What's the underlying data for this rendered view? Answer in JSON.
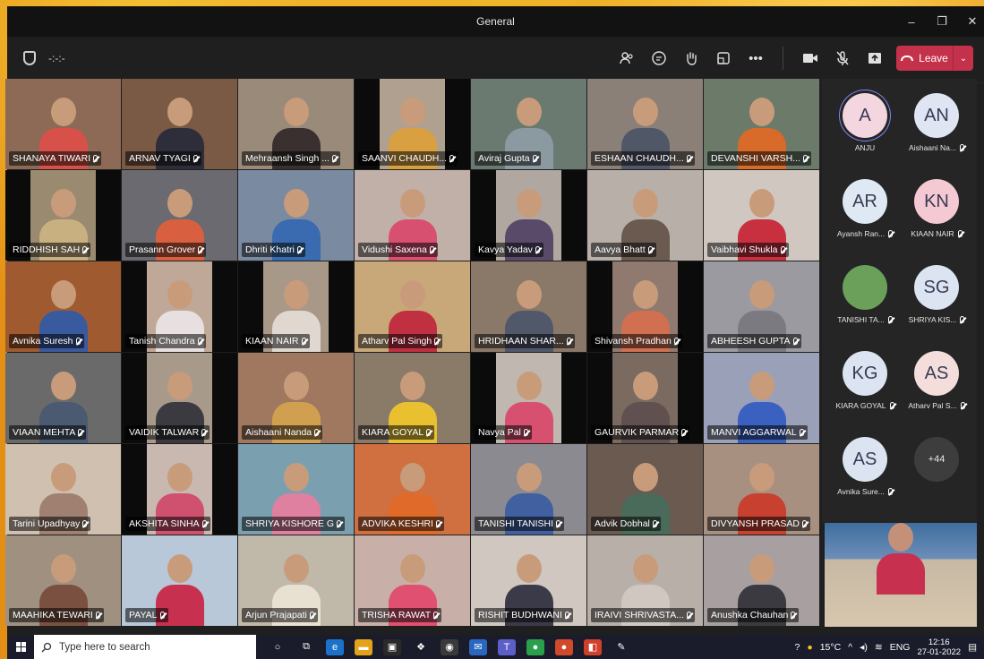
{
  "window": {
    "title": "General",
    "min": "–",
    "max": "❐",
    "close": "✕"
  },
  "toolbar": {
    "timer": "-:-:-",
    "leave_label": "Leave",
    "icons": [
      "people-icon",
      "chat-icon",
      "raise-hand-icon",
      "share-tray-icon",
      "more-icon",
      "camera-icon",
      "mic-off-icon",
      "share-icon"
    ]
  },
  "tiles": [
    {
      "name": "SHANAYA TIWARI",
      "bg": "#8c6a55",
      "shirt": "#d8504a"
    },
    {
      "name": "ARNAV TYAGI",
      "bg": "#7a5a45",
      "shirt": "#2e2e3a"
    },
    {
      "name": "Mehraansh Singh ...",
      "bg": "#9a8a7a",
      "shirt": "#3a3030"
    },
    {
      "name": "SAANVI CHAUDH...",
      "bg": "#b0a090",
      "shirt": "#d8a040",
      "bars": true
    },
    {
      "name": "Aviraj Gupta",
      "bg": "#6a7a70",
      "shirt": "#8a9aa0"
    },
    {
      "name": "ESHAAN CHAUDH...",
      "bg": "#8a8078",
      "shirt": "#505868"
    },
    {
      "name": "DEVANSHI VARSH...",
      "bg": "#6c7a6a",
      "shirt": "#d86a2a"
    },
    {
      "name": "RIDDHISH SAH",
      "bg": "#9a8a70",
      "shirt": "#c8b080",
      "bars": true
    },
    {
      "name": "Prasann Grover",
      "bg": "#6a6a70",
      "shirt": "#d86040"
    },
    {
      "name": "Dhriti Khatri",
      "bg": "#7a8aa0",
      "shirt": "#3a6ab0"
    },
    {
      "name": "Vidushi Saxena",
      "bg": "#c0b0a8",
      "shirt": "#d85070"
    },
    {
      "name": "Kavya Yadav",
      "bg": "#b0a8a0",
      "shirt": "#5a4a6a",
      "bars": true
    },
    {
      "name": "Aavya Bhatt",
      "bg": "#b8b0a8",
      "shirt": "#6a5a50"
    },
    {
      "name": "Vaibhavi Shukla",
      "bg": "#d0c8c0",
      "shirt": "#c83040"
    },
    {
      "name": "Avnika Suresh",
      "bg": "#a05a30",
      "shirt": "#3a5aa0"
    },
    {
      "name": "Tanish Chandra",
      "bg": "#c0a898",
      "shirt": "#e8e0e0",
      "bars": true
    },
    {
      "name": "KIAAN NAIR",
      "bg": "#a89888",
      "shirt": "#e0d8d0",
      "bars": true
    },
    {
      "name": "Atharv Pal Singh",
      "bg": "#c8a878",
      "shirt": "#c03040"
    },
    {
      "name": "HRIDHAAN SHAR...",
      "bg": "#8a7868",
      "shirt": "#50586a"
    },
    {
      "name": "Shivansh Pradhan",
      "bg": "#907a70",
      "shirt": "#d07050",
      "bars": true
    },
    {
      "name": "ABHEESH GUPTA",
      "bg": "#9a9aa0",
      "shirt": "#7a7a80"
    },
    {
      "name": "VIAAN MEHTA",
      "bg": "#6a6a6a",
      "shirt": "#4a5a70"
    },
    {
      "name": "VAIDIK TALWAR",
      "bg": "#a89a8a",
      "shirt": "#3a3a40",
      "bars": true
    },
    {
      "name": "Aishaani Nanda",
      "bg": "#a07860",
      "shirt": "#d0a050"
    },
    {
      "name": "KIARA GOYAL",
      "bg": "#8a7a68",
      "shirt": "#e8c030"
    },
    {
      "name": "Navya Pal",
      "bg": "#c0b8b0",
      "shirt": "#d85070",
      "bars": true
    },
    {
      "name": "GAURVIK PARMAR",
      "bg": "#7a6a60",
      "shirt": "#605050",
      "bars": true
    },
    {
      "name": "MANVI AGGARWAL",
      "bg": "#9aa0b8",
      "shirt": "#3a60c0"
    },
    {
      "name": "Tarini Upadhyay",
      "bg": "#d0c0b0",
      "shirt": "#a08070"
    },
    {
      "name": "AKSHITA SINHA",
      "bg": "#c8b8b0",
      "shirt": "#d05070",
      "bars": true
    },
    {
      "name": "SHRIYA KISHORE G",
      "bg": "#7aa0b0",
      "shirt": "#e080a0"
    },
    {
      "name": "ADVIKA KESHRI",
      "bg": "#d07040",
      "shirt": "#e06a2a"
    },
    {
      "name": "TANISHI TANISHI",
      "bg": "#8a8a90",
      "shirt": "#4060a0"
    },
    {
      "name": "Advik Dobhal",
      "bg": "#6a5a50",
      "shirt": "#4a6a5a"
    },
    {
      "name": "DIVYANSH PRASAD",
      "bg": "#a89080",
      "shirt": "#c84030"
    },
    {
      "name": "MAAHIKA TEWARI",
      "bg": "#a09080",
      "shirt": "#7a5040"
    },
    {
      "name": "PAYAL",
      "bg": "#b8c8d8",
      "shirt": "#c83050"
    },
    {
      "name": "Arjun Prajapati",
      "bg": "#c0b8a8",
      "shirt": "#e8e0d0"
    },
    {
      "name": "TRISHA RAWAT",
      "bg": "#c8b0a8",
      "shirt": "#e05070"
    },
    {
      "name": "RISHIT BUDHWANI",
      "bg": "#d0c8c0",
      "shirt": "#3a3a48"
    },
    {
      "name": "Ayansh Rangan",
      "bg": "#90806a",
      "shirt": "#6a8a5a",
      "bars": true
    },
    {
      "name": "ANJU",
      "bg": "#c0b0a0",
      "shirt": "#e8e0d8"
    }
  ],
  "extra_tiles": [
    {
      "name": "IRAIVI SHRIVASTA...",
      "bg": "#b8b0a8",
      "shirt": "#d0c8c0"
    },
    {
      "name": "Anushka Chauhan",
      "bg": "#a8a0a0",
      "shirt": "#3a3a40"
    }
  ],
  "participants": [
    {
      "initials": "A",
      "label": "ANJU",
      "color": "#f3d6df",
      "active": true
    },
    {
      "initials": "AN",
      "label": "Aishaani Na...",
      "color": "#dfe5f3"
    },
    {
      "initials": "AR",
      "label": "Ayansh Ran...",
      "color": "#dfe9f3"
    },
    {
      "initials": "KN",
      "label": "KIAAN NAIR",
      "color": "#f4c9d3"
    },
    {
      "initials": "",
      "label": "TANISHI TA...",
      "color": "#6aa05a"
    },
    {
      "initials": "SG",
      "label": "SHRIYA KIS...",
      "color": "#dbe4f0"
    },
    {
      "initials": "KG",
      "label": "KIARA GOYAL",
      "color": "#dbe4f0"
    },
    {
      "initials": "AS",
      "label": "Atharv Pal S...",
      "color": "#f3dedb"
    },
    {
      "initials": "AS",
      "label": "Avnika Sure...",
      "color": "#dbe4f0"
    }
  ],
  "more_count": "+44",
  "taskbar": {
    "search_placeholder": "Type here to search",
    "weather": "15°C",
    "lang": "ENG",
    "time": "12:16",
    "date": "27-01-2022"
  }
}
